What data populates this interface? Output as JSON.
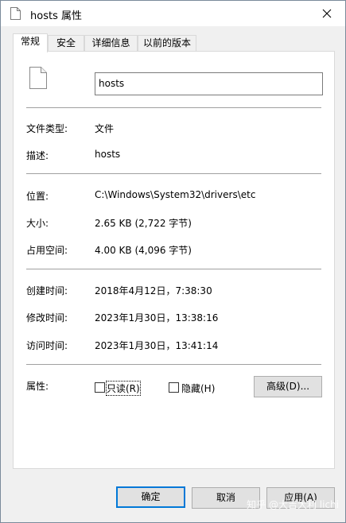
{
  "window": {
    "title": "hosts 属性",
    "close_glyph": "✕"
  },
  "tabs": [
    {
      "label": "常规",
      "active": true
    },
    {
      "label": "安全",
      "active": false
    },
    {
      "label": "详细信息",
      "active": false
    },
    {
      "label": "以前的版本",
      "active": false
    }
  ],
  "general": {
    "file_name": "hosts",
    "rows": {
      "type": {
        "label": "文件类型:",
        "value": "文件"
      },
      "description": {
        "label": "描述:",
        "value": "hosts"
      },
      "location": {
        "label": "位置:",
        "value": "C:\\Windows\\System32\\drivers\\etc"
      },
      "size": {
        "label": "大小:",
        "value": "2.65 KB (2,722 字节)"
      },
      "size_on_disk": {
        "label": "占用空间:",
        "value": "4.00 KB (4,096 字节)"
      },
      "created": {
        "label": "创建时间:",
        "value": "2018年4月12日，7:38:30"
      },
      "modified": {
        "label": "修改时间:",
        "value": "2023年1月30日，13:38:16"
      },
      "accessed": {
        "label": "访问时间:",
        "value": "2023年1月30日，13:41:14"
      }
    },
    "attributes": {
      "label": "属性:",
      "readonly": {
        "label": "只读(R)",
        "checked": false
      },
      "hidden": {
        "label": "隐藏(H)",
        "checked": false
      },
      "advanced_button": "高级(D)..."
    }
  },
  "footer": {
    "ok": "确定",
    "cancel": "取消",
    "apply": "应用(A)"
  },
  "watermark": "知乎 @大吉大利 lichi",
  "colors": {
    "accent": "#0078d7",
    "panel_bg": "#ffffff",
    "window_bg": "#f0f0f0"
  },
  "icons": {
    "title": "document-icon",
    "file": "document-icon",
    "close": "close-icon"
  }
}
